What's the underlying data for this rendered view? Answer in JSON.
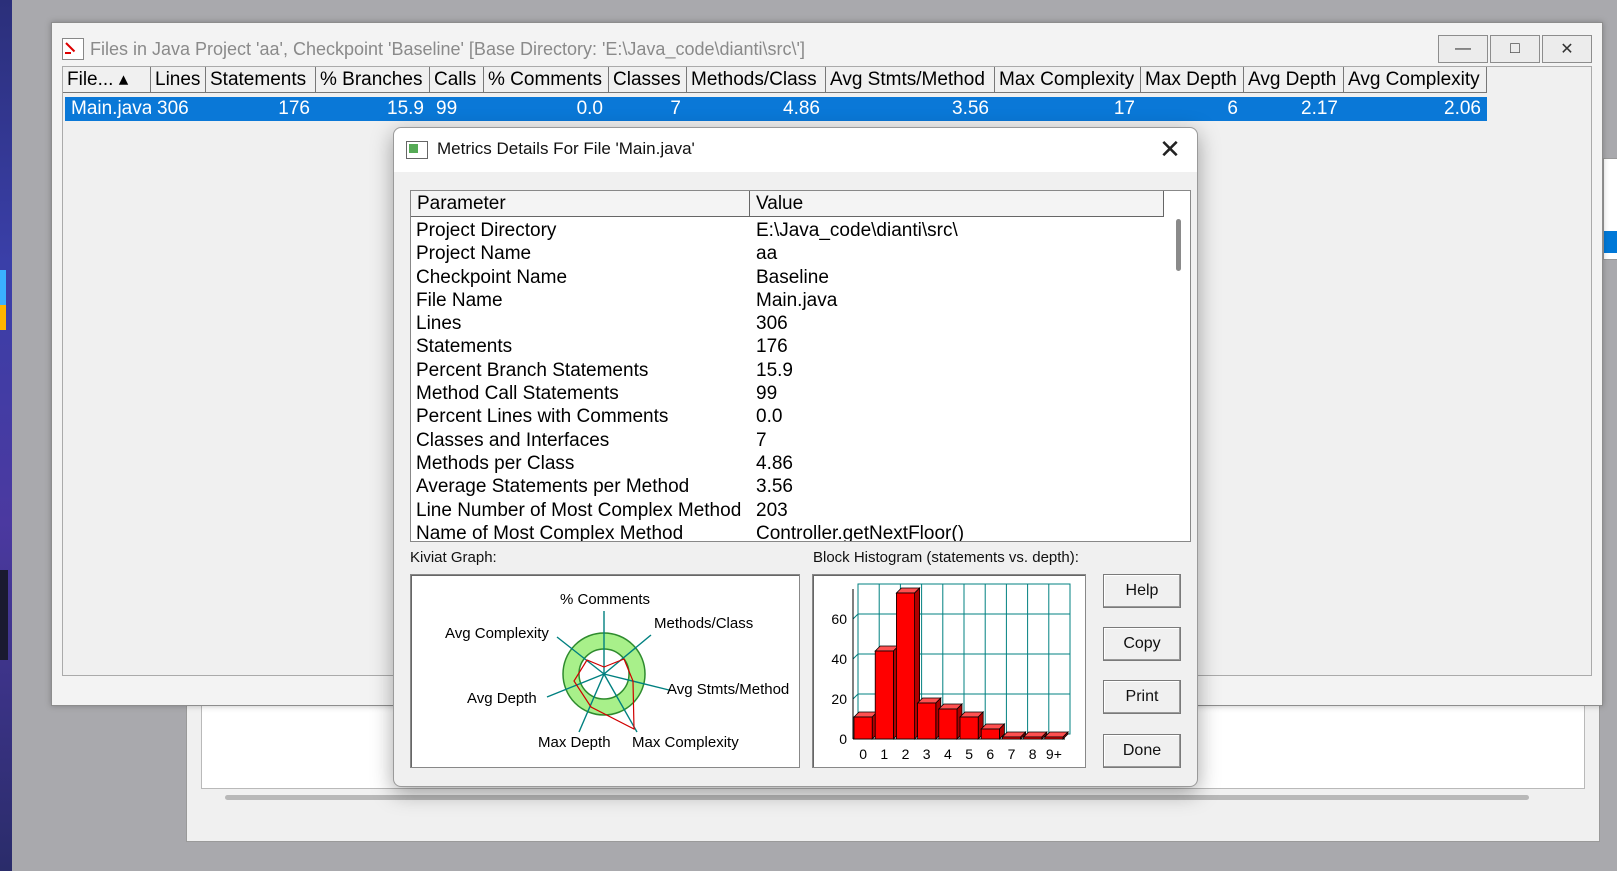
{
  "window": {
    "title": "Files in Java Project 'aa', Checkpoint 'Baseline'  [Base Directory: 'E:\\Java_code\\dianti\\src\\']",
    "minimize_label": "—",
    "maximize_label": "□",
    "close_label": "✕"
  },
  "table": {
    "headers": [
      "File... ▴",
      "Lines",
      "Statements",
      "% Branches",
      "Calls",
      "% Comments",
      "Classes",
      "Methods/Class",
      "Avg Stmts/Method",
      "Max Complexity",
      "Max Depth",
      "Avg Depth",
      "Avg Complexity"
    ],
    "row": [
      "Main.java",
      "306",
      "176",
      "15.9",
      "99",
      "0.0",
      "7",
      "4.86",
      "3.56",
      "17",
      "6",
      "2.17",
      "2.06"
    ]
  },
  "dialog": {
    "title": "Metrics Details For File 'Main.java'",
    "close_label": "✕",
    "grid_headers": [
      "Parameter",
      "Value"
    ],
    "rows": [
      {
        "param": "Project Directory",
        "value": "E:\\Java_code\\dianti\\src\\"
      },
      {
        "param": "Project Name",
        "value": "aa"
      },
      {
        "param": "Checkpoint Name",
        "value": "Baseline"
      },
      {
        "param": "File Name",
        "value": "Main.java"
      },
      {
        "param": "Lines",
        "value": "306"
      },
      {
        "param": "Statements",
        "value": "176"
      },
      {
        "param": "Percent Branch Statements",
        "value": "15.9"
      },
      {
        "param": "Method Call Statements",
        "value": "99"
      },
      {
        "param": "Percent Lines with Comments",
        "value": "0.0"
      },
      {
        "param": "Classes and Interfaces",
        "value": "7"
      },
      {
        "param": "Methods per Class",
        "value": "4.86"
      },
      {
        "param": "Average Statements per Method",
        "value": "3.56"
      },
      {
        "param": "Line Number of Most Complex Method",
        "value": "203"
      },
      {
        "param": "Name of Most Complex Method",
        "value": "Controller.getNextFloor()"
      }
    ],
    "kiviat_label": "Kiviat Graph:",
    "histogram_label": "Block Histogram (statements vs. depth):",
    "buttons": {
      "help": "Help",
      "copy": "Copy",
      "print": "Print",
      "done": "Done"
    }
  },
  "kiviat": {
    "axes": [
      "% Comments",
      "Methods/Class",
      "Avg Stmts/Method",
      "Max Complexity",
      "Max Depth",
      "Avg Depth",
      "Avg Complexity"
    ]
  },
  "chart_data": {
    "type": "bar",
    "categories": [
      "0",
      "1",
      "2",
      "3",
      "4",
      "5",
      "6",
      "7",
      "8",
      "9+"
    ],
    "values": [
      11,
      44,
      73,
      18,
      15,
      11,
      5,
      1,
      1,
      1
    ],
    "title": "Block Histogram (statements vs. depth):",
    "yticks": [
      0,
      20,
      40,
      60
    ],
    "ylim": [
      0,
      75
    ],
    "grid": true,
    "colors": {
      "bar": "#ff0000",
      "grid": "#008080"
    }
  },
  "colors": {
    "selection": "#0a78d7",
    "kiviat_fill": "#a8f08a",
    "kiviat_line": "#d00000"
  }
}
